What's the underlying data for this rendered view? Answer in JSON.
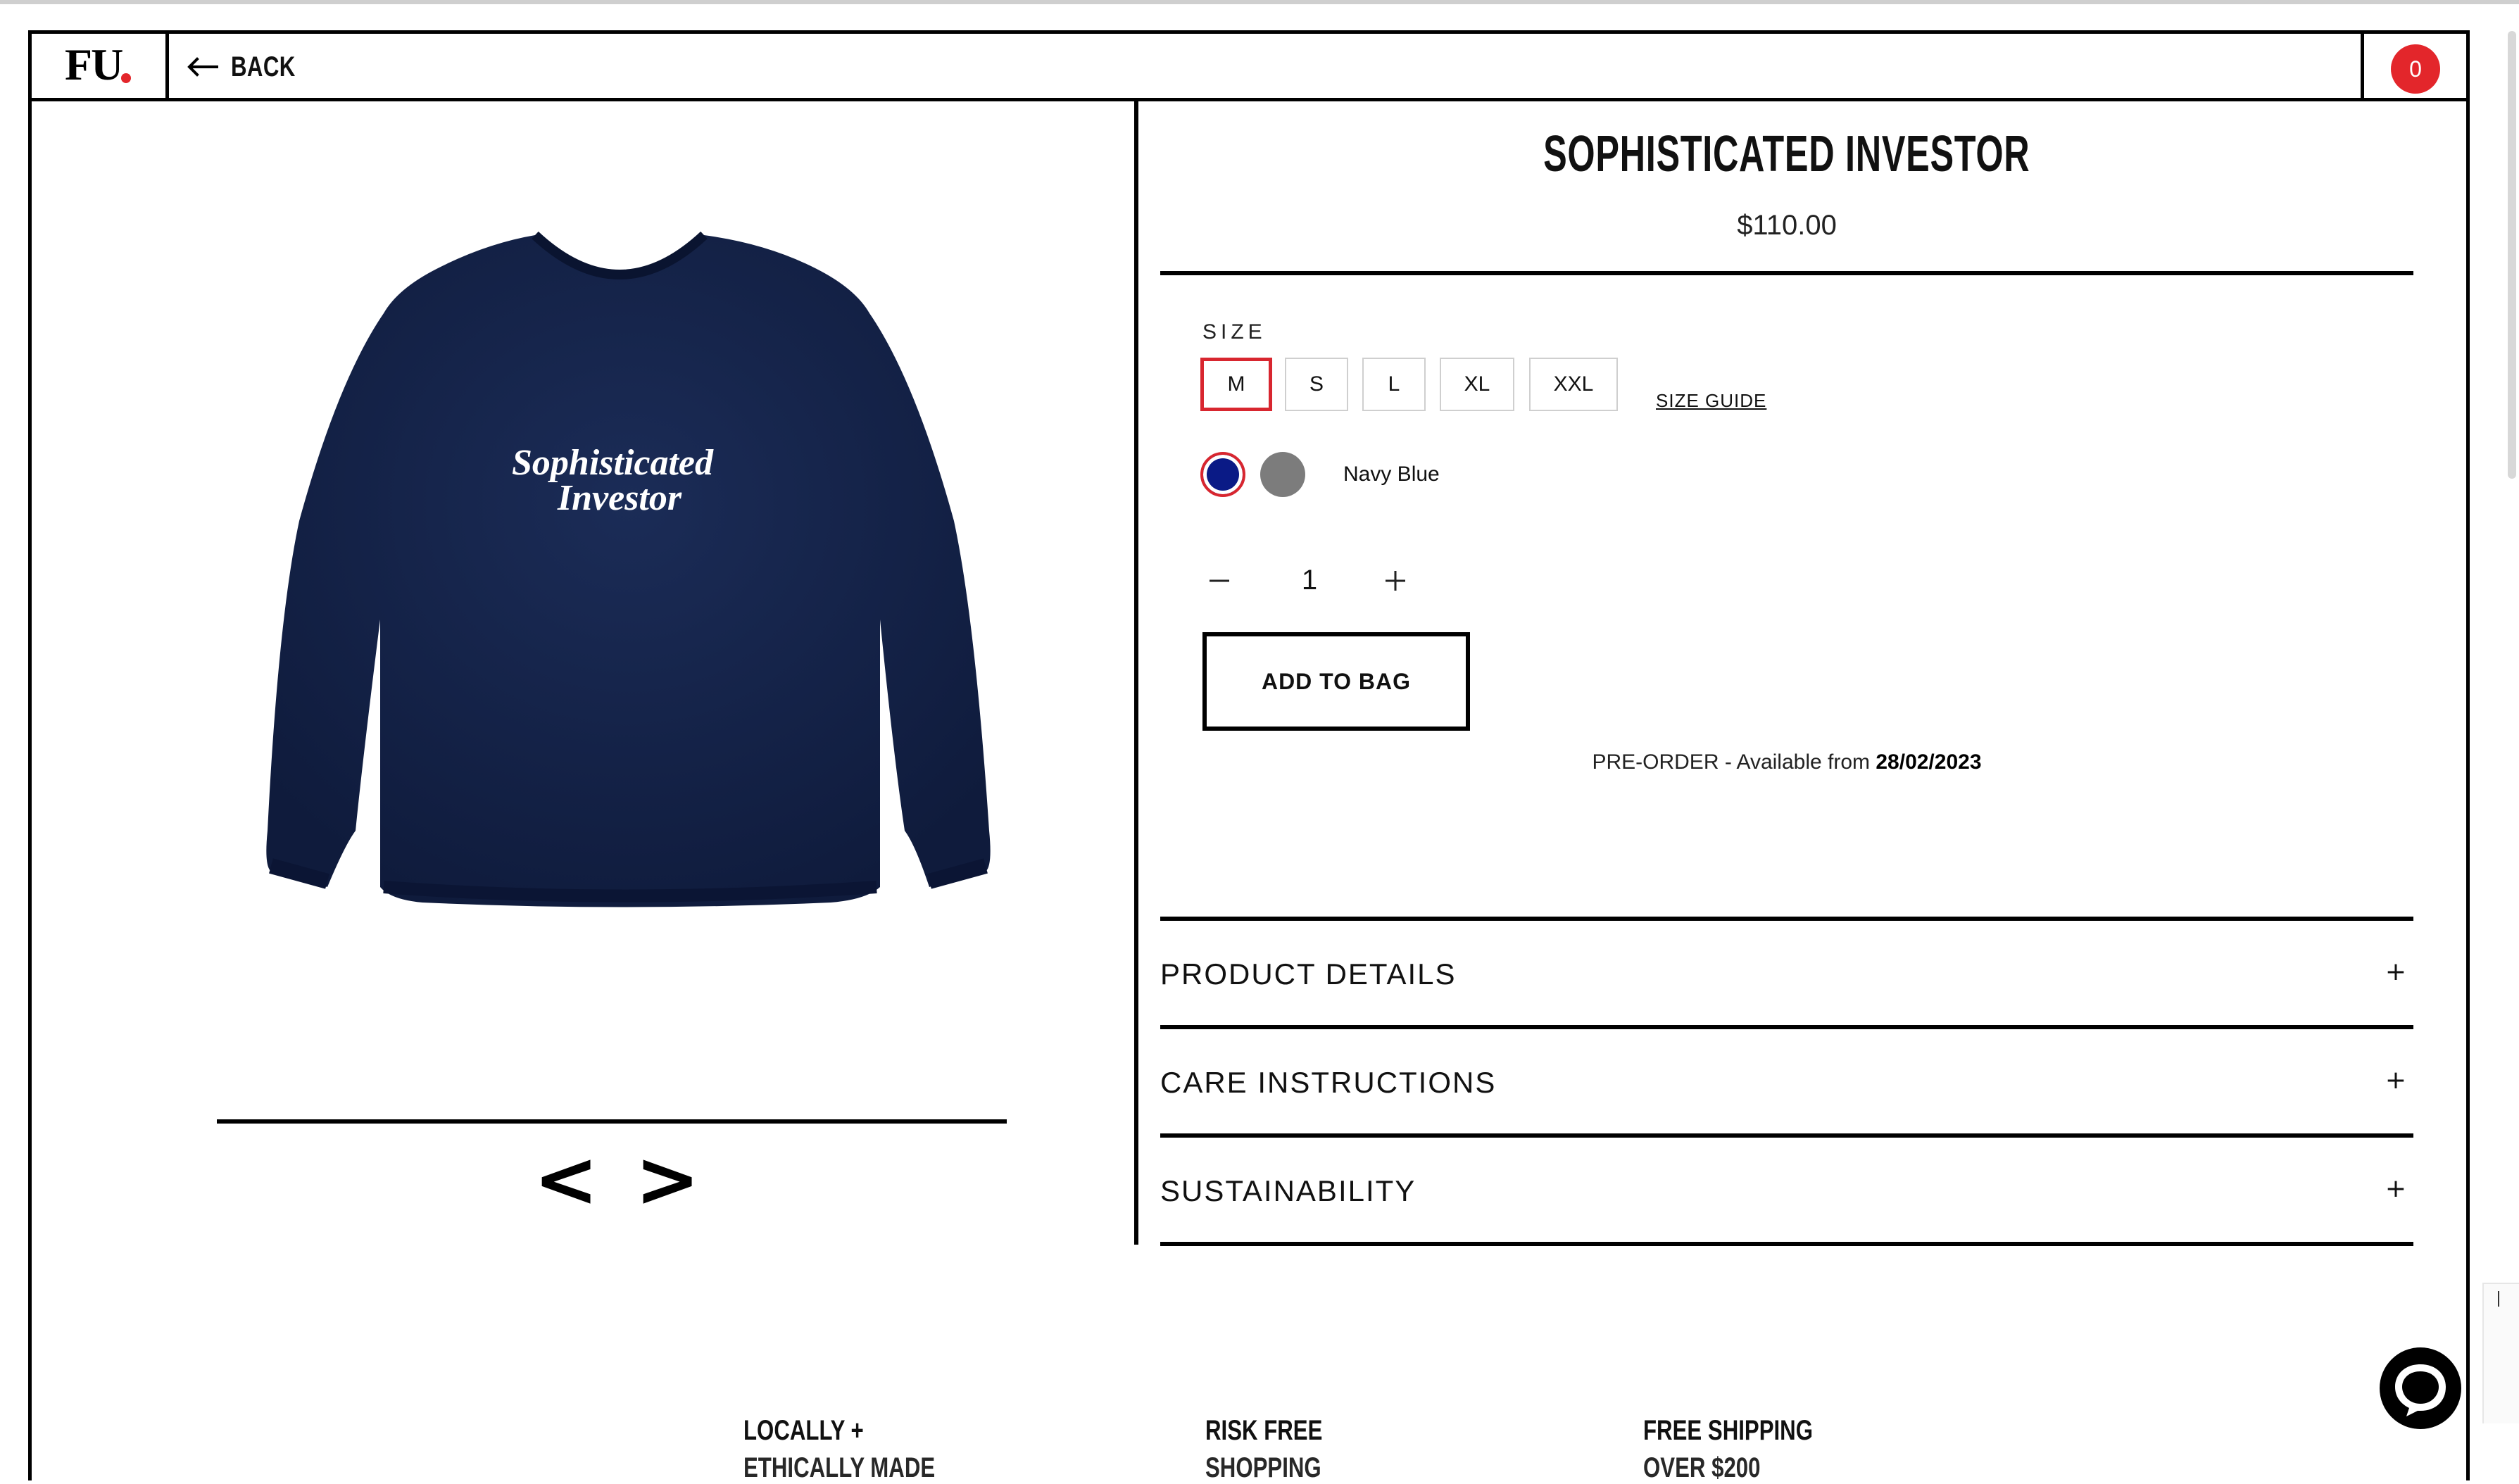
{
  "header": {
    "logo_text": "FU",
    "back_label": "BACK",
    "cart_count": "0"
  },
  "product": {
    "title": "SOPHISTICATED INVESTOR",
    "price": "$110.00",
    "image_text_line1": "Sophisticated",
    "image_text_line2": "Investor",
    "size_label": "SIZE",
    "sizes": [
      "M",
      "S",
      "L",
      "XL",
      "XXL"
    ],
    "selected_size": "M",
    "size_guide": "SIZE GUIDE",
    "colors": [
      {
        "name": "Navy Blue",
        "hex": "#0a1a86",
        "selected": true
      },
      {
        "name": "Grey",
        "hex": "#7c7c7c",
        "selected": false
      }
    ],
    "color_name": "Navy Blue",
    "quantity": "1",
    "add_to_bag": "ADD TO BAG",
    "preorder_prefix": "PRE-ORDER - Available from ",
    "preorder_date": "28/02/2023"
  },
  "gallery": {
    "prev": "<",
    "next": ">"
  },
  "accordion": [
    {
      "label": "PRODUCT DETAILS",
      "toggle": "+"
    },
    {
      "label": "CARE INSTRUCTIONS",
      "toggle": "+"
    },
    {
      "label": "SUSTAINABILITY",
      "toggle": "+"
    }
  ],
  "features": [
    {
      "line1": "LOCALLY +",
      "line2": "ETHICALLY MADE"
    },
    {
      "line1": "RISK FREE",
      "line2": "SHOPPING"
    },
    {
      "line1": "FREE SHIPPING",
      "line2": "OVER $200"
    }
  ],
  "colors": {
    "accent": "#e3262b",
    "border": "#000000",
    "swatch_navy": "#0a1a86",
    "swatch_grey": "#7c7c7c",
    "sweater": "#142348"
  }
}
